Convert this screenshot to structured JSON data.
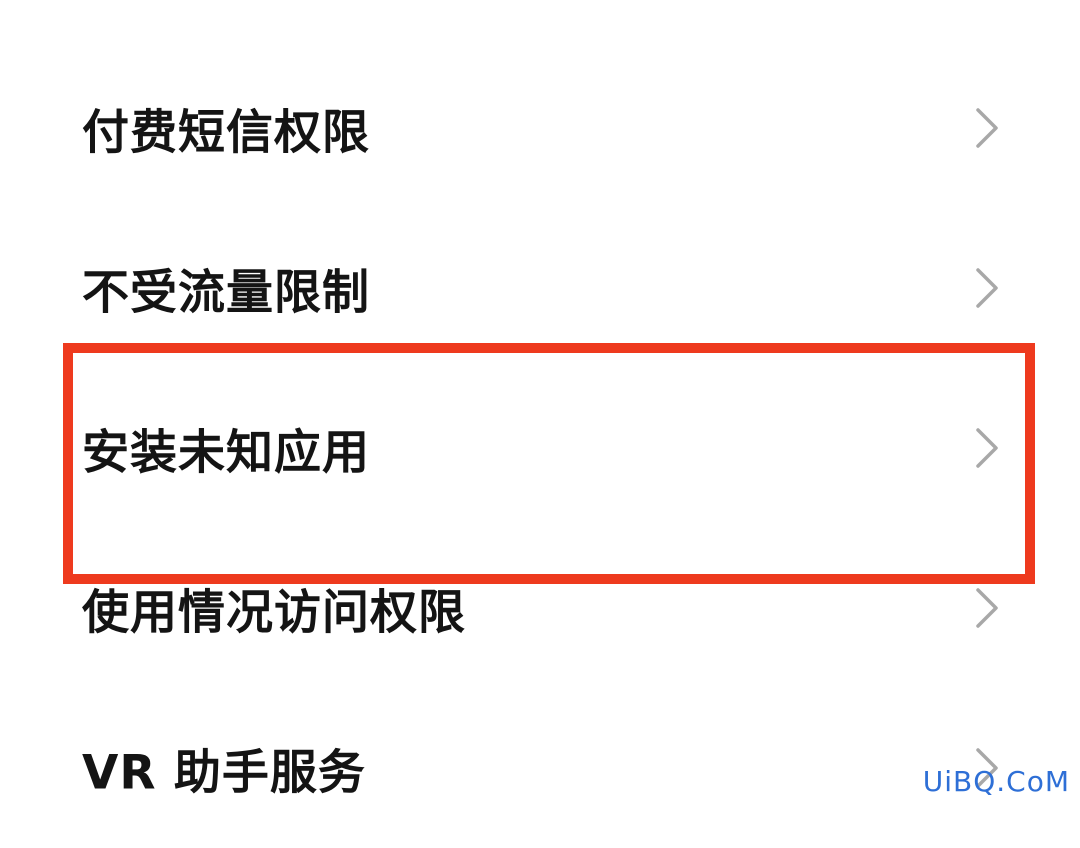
{
  "settings": {
    "items": [
      {
        "label": "付费短信权限"
      },
      {
        "label": "不受流量限制"
      },
      {
        "label": "安装未知应用"
      },
      {
        "label": "使用情况访问权限"
      },
      {
        "label": "VR 助手服务"
      }
    ]
  },
  "highlight": {
    "target": "安装未知应用",
    "color": "#ee3a1e"
  },
  "watermark": {
    "text": "UiBQ.CoM"
  },
  "icons": {
    "row_trailing": "chevron-right-icon"
  }
}
